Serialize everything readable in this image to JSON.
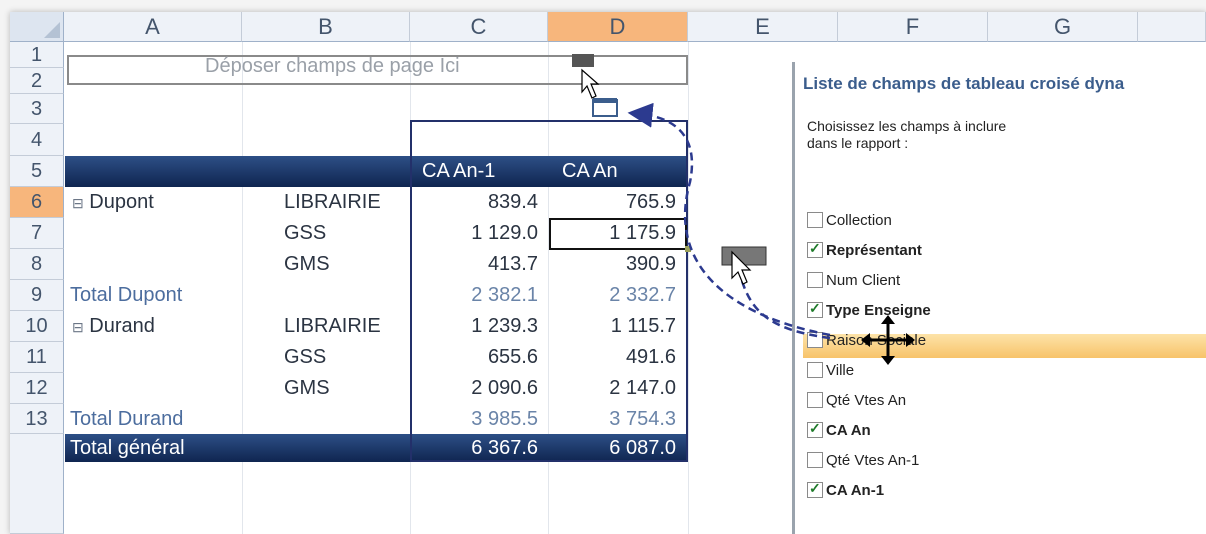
{
  "columns": [
    "A",
    "B",
    "C",
    "D",
    "E",
    "F",
    "G"
  ],
  "selected_column": "D",
  "rows": [
    "1",
    "2",
    "3",
    "4",
    "5",
    "6",
    "7",
    "8",
    "9",
    "10",
    "11",
    "12",
    "13"
  ],
  "selected_row": "6",
  "drop_zone_text": "Déposer champs de page Ici",
  "pivot": {
    "col_headers": [
      "CA An-1",
      "CA An"
    ],
    "dupont": {
      "name": "Dupont",
      "lines": [
        [
          "LIBRAIRIE",
          "839.4",
          "765.9"
        ],
        [
          "GSS",
          "1 129.0",
          "1 175.9"
        ],
        [
          "GMS",
          "413.7",
          "390.9"
        ]
      ],
      "total_label": "Total Dupont",
      "total": [
        "2 382.1",
        "2 332.7"
      ]
    },
    "durand": {
      "name": "Durand",
      "lines": [
        [
          "LIBRAIRIE",
          "1 239.3",
          "1 115.7"
        ],
        [
          "GSS",
          "655.6",
          "491.6"
        ],
        [
          "GMS",
          "2 090.6",
          "2 147.0"
        ]
      ],
      "total_label": "Total Durand",
      "total": [
        "3 985.5",
        "3 754.3"
      ]
    },
    "grand_total_label": "Total général",
    "grand_total": [
      "6 367.6",
      "6 087.0"
    ],
    "expand_symbol": "⊟"
  },
  "field_list": {
    "title": "Liste de champs de tableau croisé dyna",
    "hint": "Choisissez les champs à inclure dans le rapport :",
    "fields": [
      {
        "label": "Collection",
        "checked": false
      },
      {
        "label": "Représentant",
        "checked": true
      },
      {
        "label": "Num Client",
        "checked": false
      },
      {
        "label": "Type Enseigne",
        "checked": true
      },
      {
        "label": "Raison Sociale",
        "checked": false
      },
      {
        "label": "Ville",
        "checked": false
      },
      {
        "label": "Qté Vtes An",
        "checked": false
      },
      {
        "label": "CA An",
        "checked": true
      },
      {
        "label": "Qté Vtes An-1",
        "checked": false
      },
      {
        "label": "CA An-1",
        "checked": true
      }
    ]
  },
  "colors": {
    "accent": "#3b5d8c",
    "pivot_header": "#0f2550",
    "selection": "#f7b67c",
    "drag_arrow": "#2c3a8f"
  }
}
